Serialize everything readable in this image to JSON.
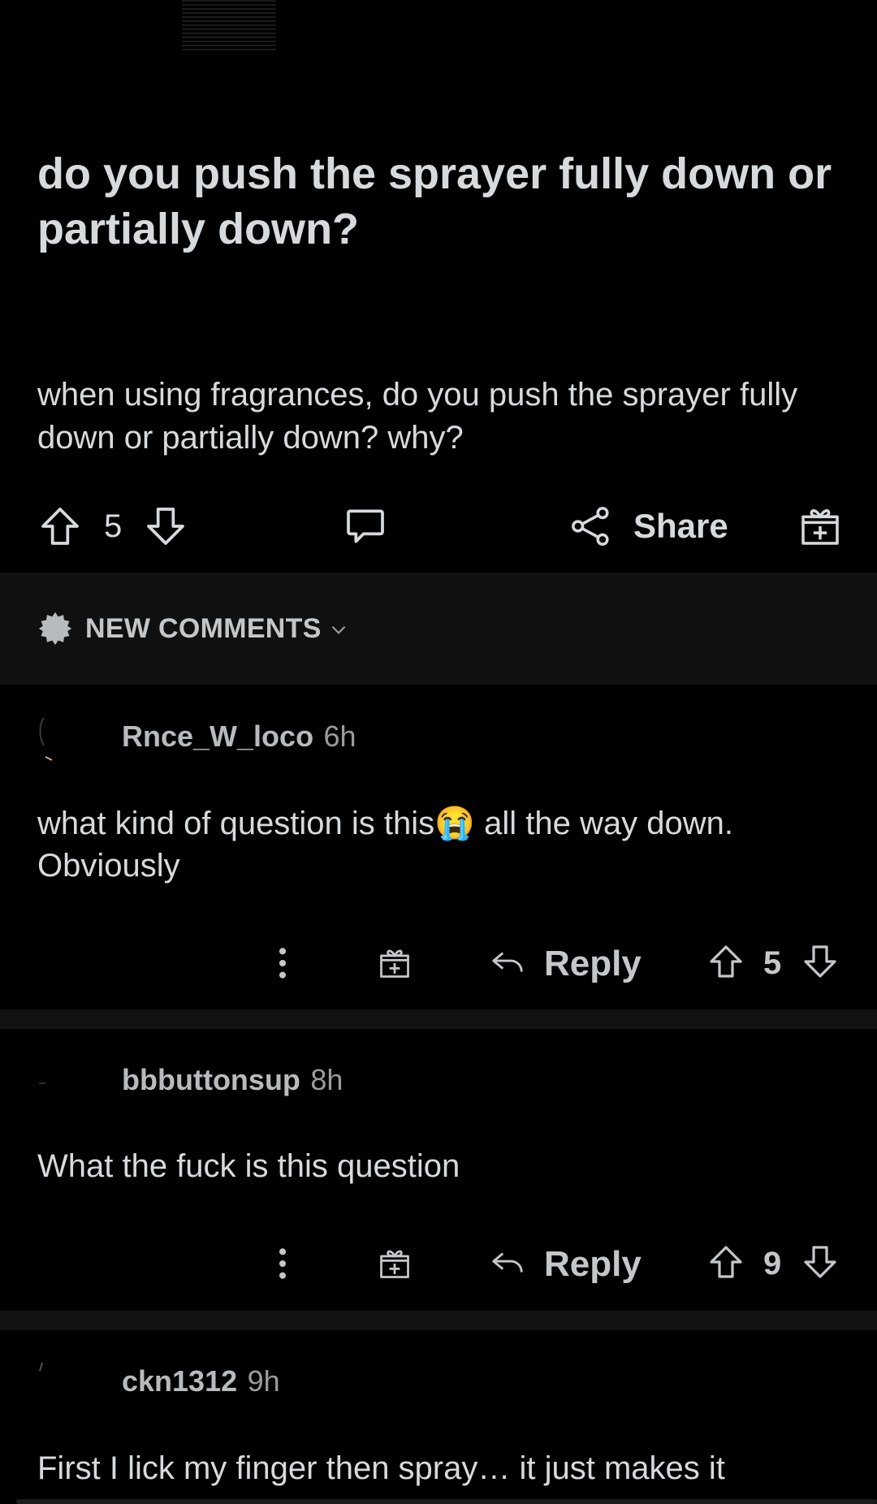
{
  "post": {
    "title": "do you push the sprayer fully down or partially down?",
    "body": "when using fragrances, do you push the sprayer fully down or partially down? why?",
    "vote_count": "5",
    "share_label": "Share"
  },
  "sort": {
    "label": "NEW COMMENTS"
  },
  "comments": [
    {
      "author": "Rnce_W_loco",
      "age": "6h",
      "text_before": "what kind of question is this",
      "emoji": "😭",
      "text_after": " all the way down. Obviously",
      "reply_label": "Reply",
      "votes": "5"
    },
    {
      "author": "bbbuttonsup",
      "age": "8h",
      "text": "What the fuck is this question",
      "reply_label": "Reply",
      "votes": "9"
    },
    {
      "author": "ckn1312",
      "age": "9h",
      "text": "First I lick my finger then spray… it just makes it"
    }
  ],
  "icons": {
    "upvote": "upvote-icon",
    "downvote": "downvote-icon",
    "comment": "comment-icon",
    "share": "share-icon",
    "award": "award-icon",
    "sort": "sort-badge-icon",
    "more": "more-options-icon",
    "reply": "reply-icon"
  },
  "colors": {
    "background": "#000000",
    "text": "#d7dadc",
    "muted": "#9a9c9e",
    "bar": "#101010"
  }
}
